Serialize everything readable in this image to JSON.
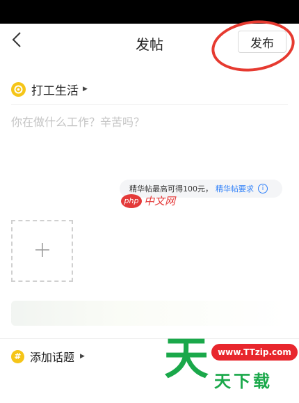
{
  "header": {
    "title": "发帖",
    "publish_label": "发布"
  },
  "category": {
    "label": "打工生活"
  },
  "post": {
    "placeholder": "你在做什么工作？辛苦吗？"
  },
  "tip": {
    "text": "精华帖最高可得100元，",
    "link": "精华帖要求",
    "info_icon": "i"
  },
  "topic": {
    "label": "添加话题",
    "icon": "#"
  },
  "watermarks": {
    "php_logo": "php",
    "php_cn": "中文网",
    "site_glyph": "天",
    "site_url": "www.TTzip.com",
    "site_name": "天下载"
  },
  "colors": {
    "accent_yellow": "#f5c518",
    "link_blue": "#2d7ff9",
    "annotation_red": "#e63a30"
  }
}
